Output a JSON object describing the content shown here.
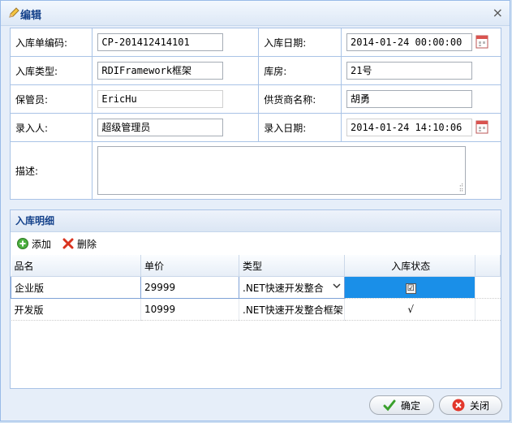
{
  "window": {
    "title": "编辑"
  },
  "form": {
    "rows": [
      {
        "l1": "入库单编码:",
        "v1": "CP-201412414101",
        "l2": "入库日期:",
        "v2": "2014-01-24 00:00:00"
      },
      {
        "l1": "入库类型:",
        "v1": "RDIFramework框架",
        "l2": "库房:",
        "v2": "21号"
      },
      {
        "l1": "保管员:",
        "v1": "EricHu",
        "l2": "供货商名称:",
        "v2": "胡勇"
      },
      {
        "l1": "录入人:",
        "v1": "超级管理员",
        "l2": "录入日期:",
        "v2": "2014-01-24 14:10:06"
      }
    ],
    "desc_label": "描述:",
    "desc_value": ""
  },
  "detail": {
    "title": "入库明细",
    "add_label": "添加",
    "delete_label": "删除",
    "columns": [
      "品名",
      "单价",
      "类型",
      "入库状态"
    ],
    "rows": [
      {
        "name": "企业版",
        "price": "29999",
        "type": ".NET快速开发整合",
        "status": "☑"
      },
      {
        "name": "开发版",
        "price": "10999",
        "type": ".NET快速开发整合框架",
        "status": "√"
      }
    ]
  },
  "footer": {
    "ok_label": "确定",
    "close_label": "关闭"
  },
  "colors": {
    "selected": "#1a8fe8",
    "title": "#15428b"
  }
}
